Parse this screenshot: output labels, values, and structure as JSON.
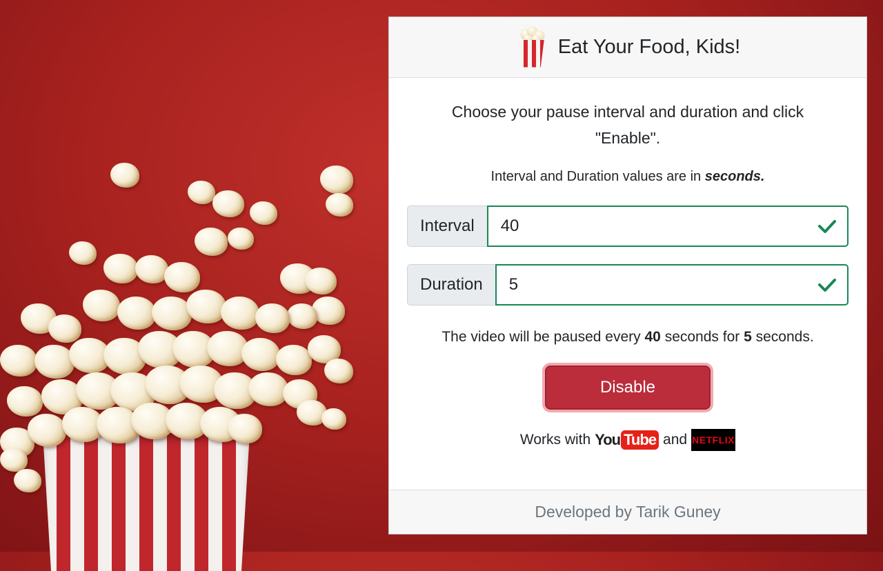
{
  "header": {
    "title": "Eat Your Food, Kids!",
    "icon": "popcorn-icon"
  },
  "body": {
    "instructions": "Choose your pause interval and duration and click \"Enable\".",
    "units_note_prefix": "Interval and Duration values are in ",
    "units_note_emphasis": "seconds.",
    "interval": {
      "label": "Interval",
      "value": "40",
      "valid": true
    },
    "duration": {
      "label": "Duration",
      "value": "5",
      "valid": true
    },
    "summary": {
      "prefix": "The video will be paused every ",
      "interval": "40",
      "middle": " seconds for ",
      "duration": "5",
      "suffix": " seconds."
    },
    "toggle_button_label": "Disable",
    "works_with": {
      "prefix": "Works with",
      "youtube_you": "You",
      "youtube_tube": "Tube",
      "conjunction": "and",
      "netflix": "NETFLIX"
    }
  },
  "footer": {
    "credit": "Developed by Tarik Guney"
  },
  "colors": {
    "valid_green": "#198754",
    "danger_button": "#bb2d3b",
    "youtube_red": "#e62117",
    "netflix_red": "#e50914"
  }
}
